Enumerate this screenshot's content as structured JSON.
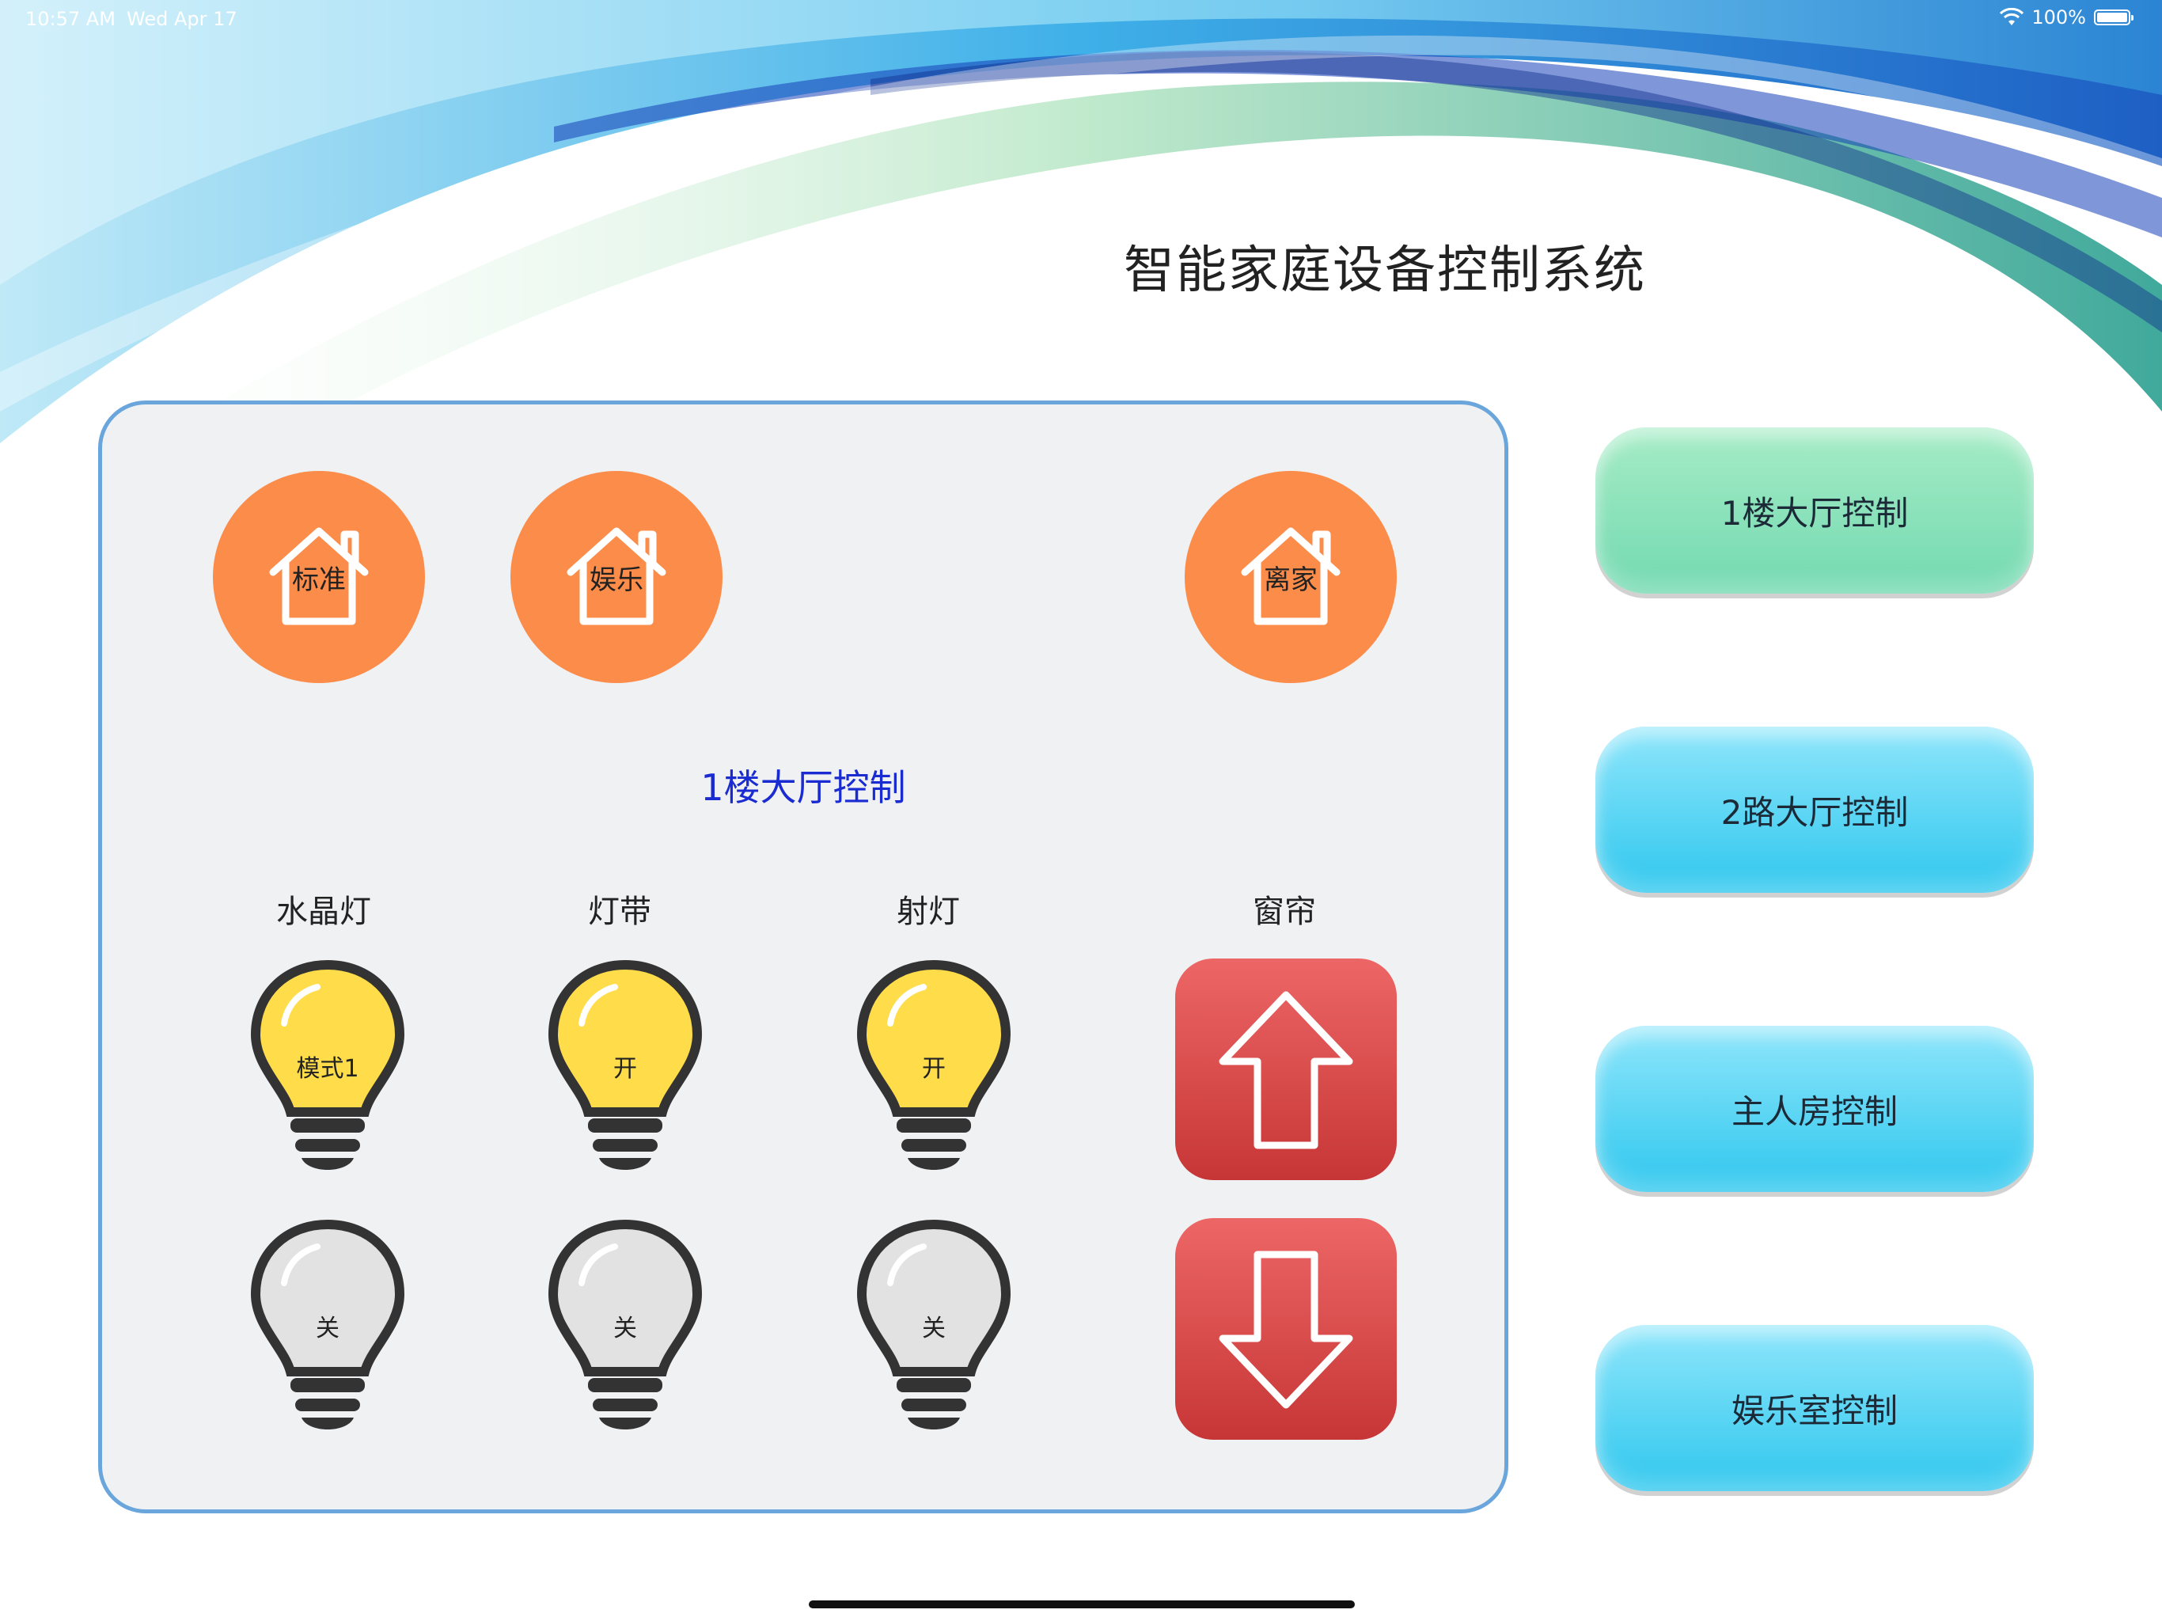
{
  "status_bar": {
    "time": "10:57 AM",
    "date": "Wed Apr 17",
    "battery": "100%"
  },
  "app_title": "智能家庭设备控制系统",
  "scenes": [
    {
      "label": "标准"
    },
    {
      "label": "娱乐"
    },
    {
      "label": "离家"
    }
  ],
  "section_title": "1楼大厅控制",
  "devices": [
    {
      "label": "水晶灯",
      "on_label": "模式1",
      "off_label": "关"
    },
    {
      "label": "灯带",
      "on_label": "开",
      "off_label": "关"
    },
    {
      "label": "射灯",
      "on_label": "开",
      "off_label": "关"
    },
    {
      "label": "窗帘"
    }
  ],
  "rooms": [
    {
      "label": "1楼大厅控制"
    },
    {
      "label": "2路大厅控制"
    },
    {
      "label": "主人房控制"
    },
    {
      "label": "娱乐室控制"
    }
  ],
  "colors": {
    "scene_orange": "#fb8c4a",
    "bulb_on": "#ffdc4a",
    "bulb_off": "#e2e2e2",
    "curtain_red": "#d94545",
    "panel_border": "#6aa6dc",
    "section_title": "#1a2bd1"
  }
}
